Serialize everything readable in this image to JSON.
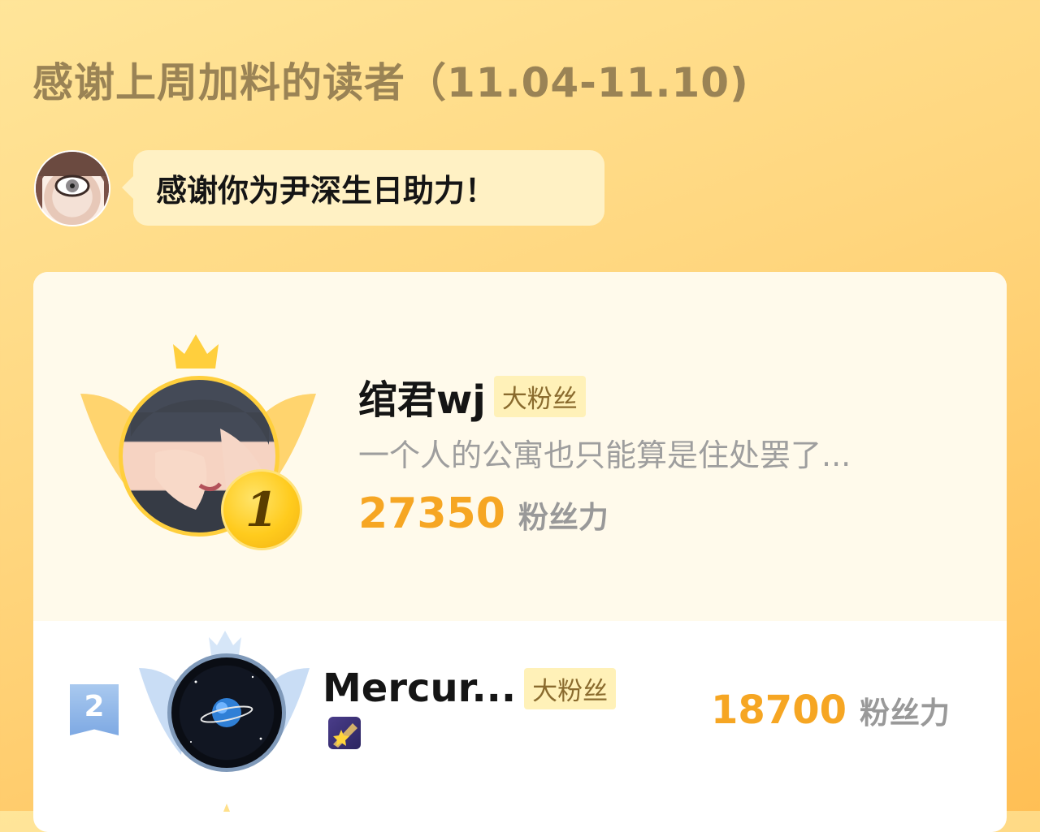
{
  "header": {
    "title": "感谢上周加料的读者（11.04-11.10)"
  },
  "host": {
    "message": "感谢你为尹深生日助力！"
  },
  "ranking": {
    "first": {
      "rank": "1",
      "name": "绾君wj",
      "badge": "大粉丝",
      "motto": "一个人的公寓也只能算是住处罢了...",
      "score": "27350",
      "score_label": "粉丝力"
    },
    "second": {
      "rank": "2",
      "name": "Mercur...",
      "badge": "大粉丝",
      "score": "18700",
      "score_label": "粉丝力"
    }
  },
  "colors": {
    "accent_orange": "#f6a623",
    "badge_bg": "#fff1b8",
    "gold": "#ffcf3d",
    "silver_blue": "#7ea9e3"
  },
  "icons": [
    "host-avatar",
    "crown-icon",
    "wings-icon",
    "rank-1-medal",
    "rank-2-flag",
    "achievement-icon"
  ]
}
